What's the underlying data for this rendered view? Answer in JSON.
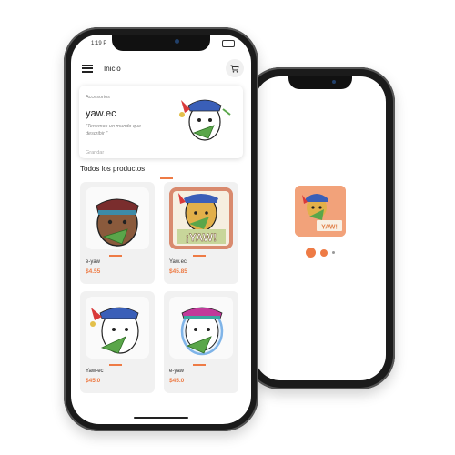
{
  "colors": {
    "accent": "#ee7b45",
    "banner_bg": "#f2a27a",
    "phone_body": "#1b1b1b"
  },
  "status_bar": {
    "time": "1:19 P"
  },
  "app_bar": {
    "title": "Inicio",
    "menu_icon": "menu-icon",
    "cart_icon": "cart-icon"
  },
  "banner": {
    "category": "Accesorios",
    "brand": "yaw.ec",
    "slogan": "\"Tenemos un mundo que describir \"",
    "more": "Grandar"
  },
  "section": {
    "title": "Todos los productos"
  },
  "products": [
    {
      "name": "e-yaw",
      "price": "$4.55"
    },
    {
      "name": "Yaw.ec",
      "price": "$45.85"
    },
    {
      "name": "Yaw-ec",
      "price": "$45.0"
    },
    {
      "name": "e-yaw",
      "price": "$45.0"
    }
  ],
  "splash": {
    "badge_text": "¡YAW!",
    "small_badge_text": "YAW!"
  }
}
